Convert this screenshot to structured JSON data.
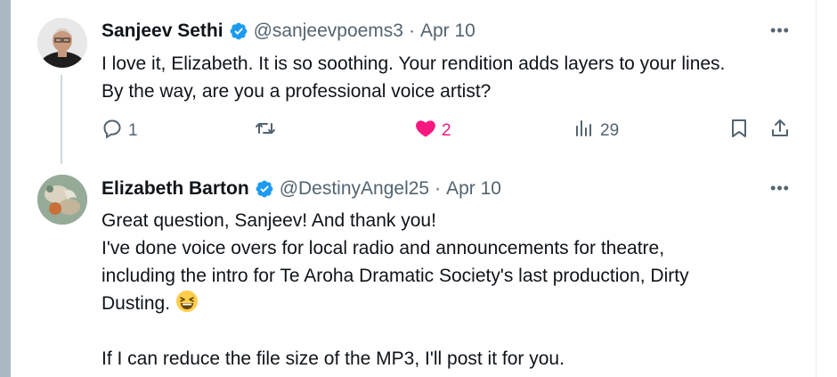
{
  "tweets": [
    {
      "author_name": "Sanjeev Sethi",
      "handle": "@sanjeevpoems3",
      "separator": "·",
      "date": "Apr 10",
      "text_lines": [
        "I love it, Elizabeth. It is so soothing. Your rendition adds layers to your lines.",
        "By the way, are you a professional voice artist?"
      ],
      "actions": {
        "replies": "1",
        "likes": "2",
        "views": "29"
      }
    },
    {
      "author_name": "Elizabeth Barton",
      "handle": "@DestinyAngel25",
      "separator": "·",
      "date": "Apr 10",
      "text_lines": [
        "Great question, Sanjeev! And thank you!",
        "I've done voice overs for local radio and announcements for theatre,",
        "including the intro for Te Aroha Dramatic Society's last production, Dirty",
        "Dusting.",
        "",
        "If I can reduce the file size of the MP3, I'll post it for you."
      ]
    }
  ],
  "icons": {
    "verified": "verified-badge-icon",
    "more": "more-icon",
    "reply": "reply-icon",
    "retweet": "retweet-icon",
    "like": "heart-icon",
    "views": "views-icon",
    "bookmark": "bookmark-icon",
    "share": "share-icon",
    "emoji": "grinning-squinting-emoji"
  },
  "colors": {
    "verified": "#1d9bf0",
    "like_active": "#f91880",
    "secondary_text": "#536471",
    "thread_line": "#cfd9de"
  },
  "more_label": "•••"
}
